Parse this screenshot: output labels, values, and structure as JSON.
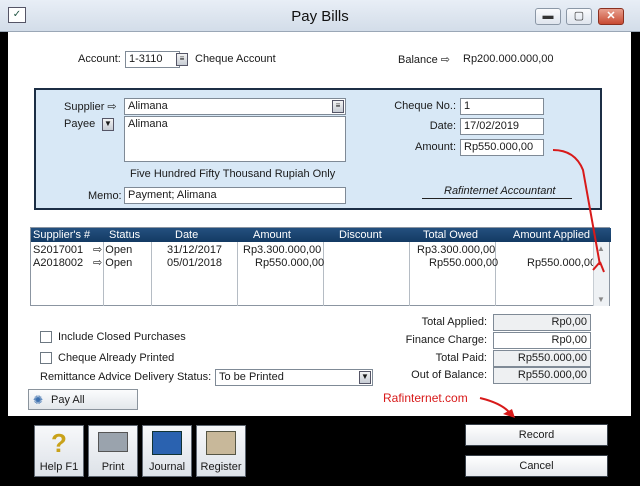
{
  "window": {
    "title": "Pay Bills",
    "minimize": "▬",
    "maximize": "▢",
    "close": "✕"
  },
  "account": {
    "label": "Account:",
    "code": "1-3110",
    "name": "Cheque Account",
    "balance_label": "Balance ⇨",
    "balance_value": "Rp200.000.000,00"
  },
  "supplier": {
    "label": "Supplier ⇨",
    "value": "Alimana"
  },
  "payee": {
    "label": "Payee",
    "value": "Alimana"
  },
  "amount_words": "Five Hundred Fifty Thousand Rupiah  Only",
  "memo": {
    "label": "Memo:",
    "value": "Payment; Alimana"
  },
  "cheque_no": {
    "label": "Cheque No.:",
    "value": "1"
  },
  "date": {
    "label": "Date:",
    "value": "17/02/2019"
  },
  "amount": {
    "label": "Amount:",
    "value": "Rp550.000,00"
  },
  "signature": "Rafinternet Accountant",
  "table": {
    "headers": [
      "Supplier's #",
      "Status",
      "Date",
      "Amount",
      "Discount",
      "Total Owed",
      "Amount Applied"
    ],
    "rows": [
      {
        "supplier": "S2017001",
        "status": "⇨ Open",
        "date": "31/12/2017",
        "amount": "Rp3.300.000,00",
        "discount": "",
        "total_owed": "Rp3.300.000,00",
        "applied": ""
      },
      {
        "supplier": "A2018002",
        "status": "⇨ Open",
        "date": "05/01/2018",
        "amount": "Rp550.000,00",
        "discount": "",
        "total_owed": "Rp550.000,00",
        "applied": "Rp550.000,00"
      }
    ]
  },
  "options": {
    "include_closed": "Include Closed Purchases",
    "cheque_printed": "Cheque Already Printed",
    "remittance_label": "Remittance Advice Delivery Status:",
    "remittance_value": "To be Printed"
  },
  "totals": {
    "applied_label": "Total Applied:",
    "applied_value": "Rp0,00",
    "finance_label": "Finance Charge:",
    "finance_value": "Rp0,00",
    "paid_label": "Total Paid:",
    "paid_value": "Rp550.000,00",
    "oob_label": "Out of Balance:",
    "oob_value": "Rp550.000,00"
  },
  "pay_all": "Pay All",
  "watermark": "Rafinternet.com",
  "toolbar": {
    "help": "Help F1",
    "print": "Print",
    "journal": "Journal",
    "register": "Register"
  },
  "actions": {
    "record": "Record",
    "cancel": "Cancel"
  },
  "colors": {
    "panel": "#d8e8f6",
    "header": "#1c4470",
    "annotation": "#d81a1a"
  }
}
